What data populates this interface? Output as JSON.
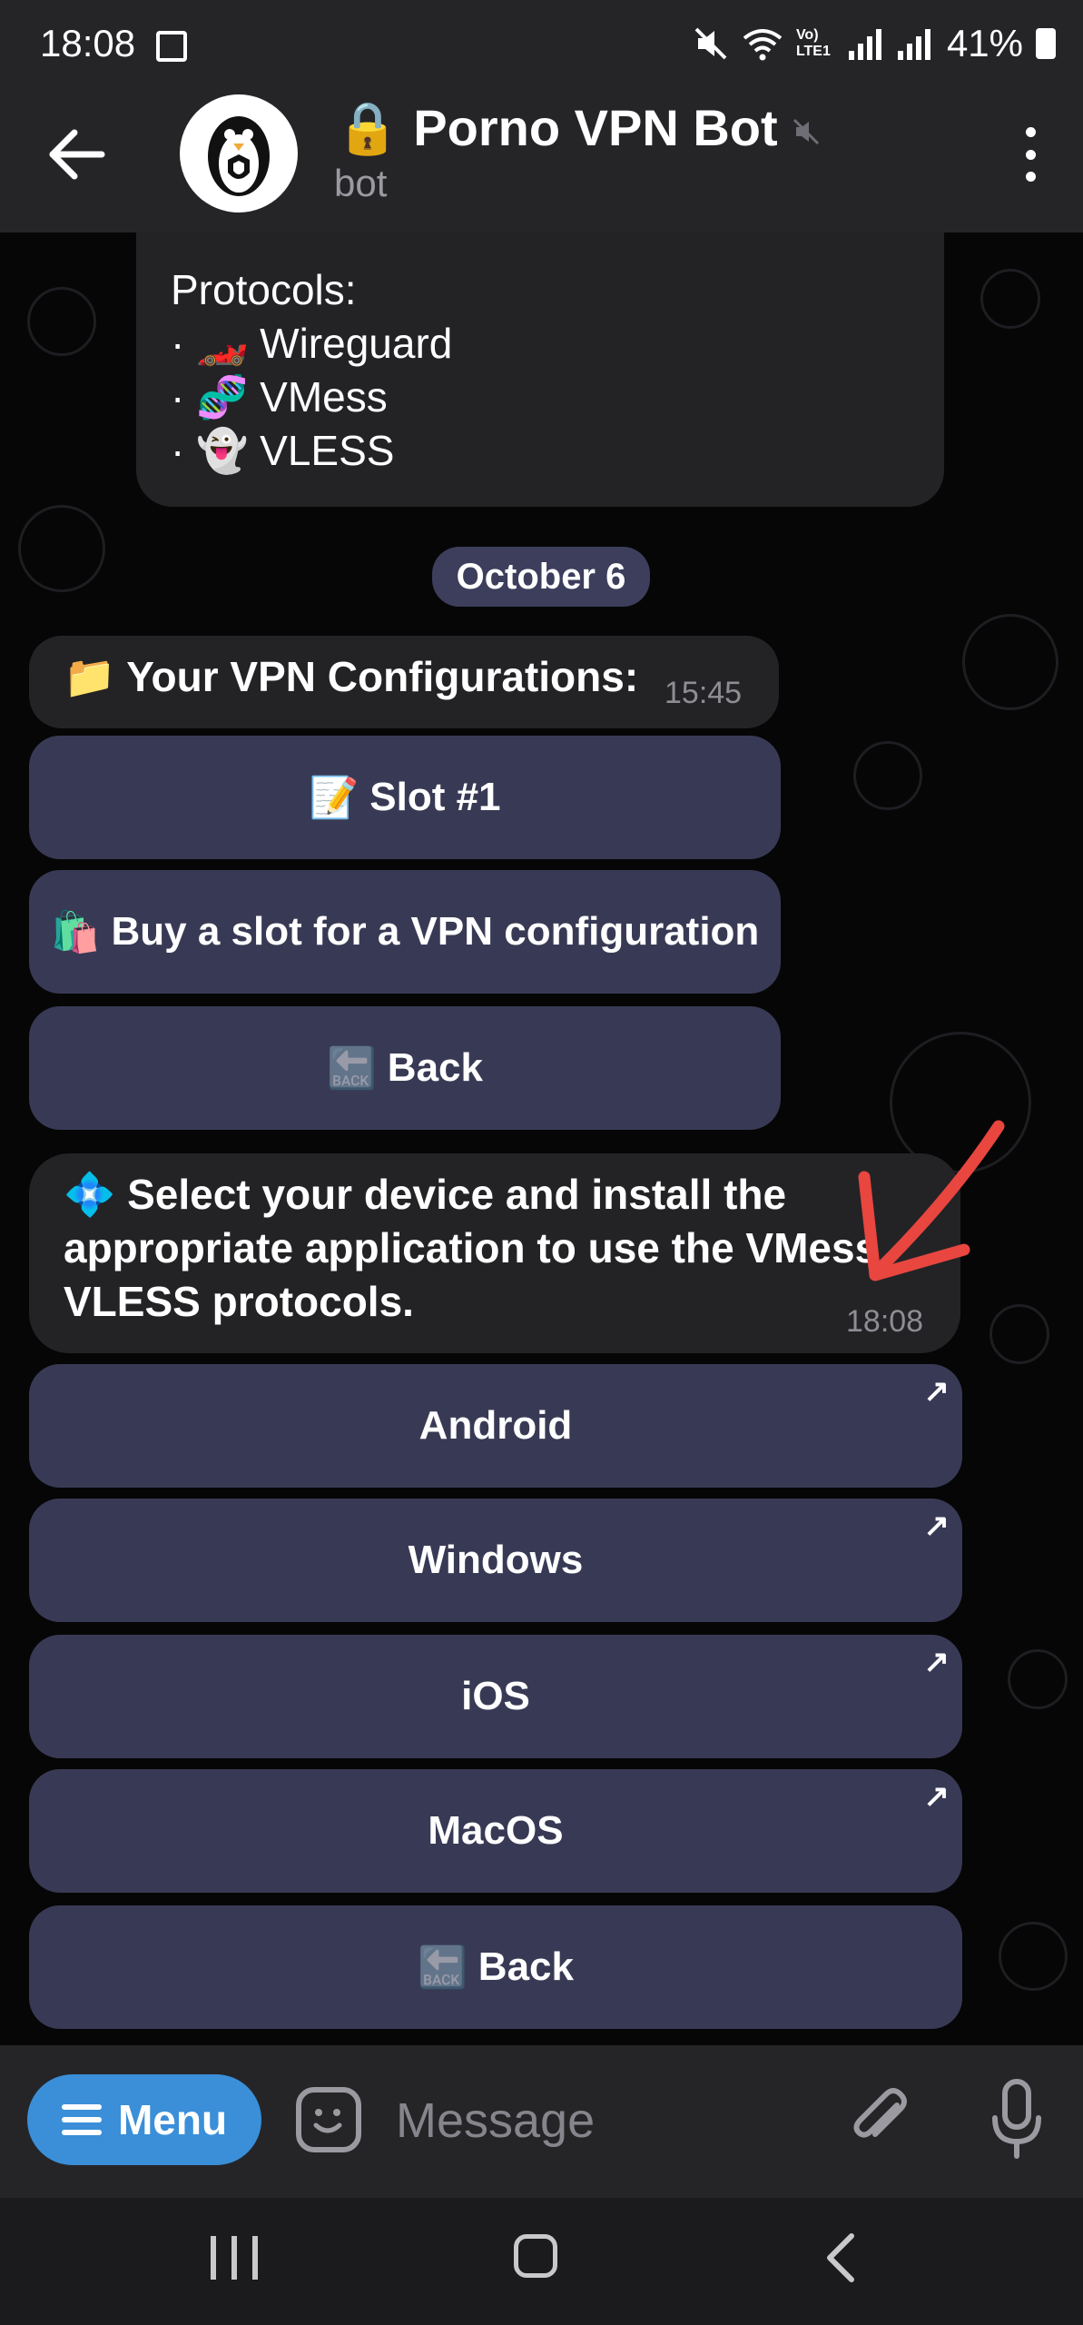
{
  "status_bar": {
    "time": "18:08",
    "network_label": "Vo) LTE1",
    "battery": "41%"
  },
  "header": {
    "title": "Porno VPN Bot",
    "title_prefix_emoji": "🔒",
    "subtitle": "bot"
  },
  "protocols_message": {
    "heading": "Protocols:",
    "items": [
      {
        "bullet": "·",
        "emoji": "🏎️",
        "label": "Wireguard"
      },
      {
        "bullet": "·",
        "emoji": "🧬",
        "label": "VMess"
      },
      {
        "bullet": "·",
        "emoji": "👻",
        "label": "VLESS"
      }
    ]
  },
  "date_separator": "October 6",
  "configs_message": {
    "emoji": "📁",
    "text": "Your VPN Configurations:",
    "time": "15:45"
  },
  "configs_buttons": [
    {
      "emoji": "📝",
      "label": "Slot #1"
    },
    {
      "emoji": "🛍️",
      "label": "Buy a slot for a VPN configuration"
    },
    {
      "emoji": "🔙",
      "label": "Back"
    }
  ],
  "device_message": {
    "emoji": "💠",
    "text": "Select your device and install the appropriate application to use the VMess VLESS protocols.",
    "time": "18:08"
  },
  "device_buttons": [
    {
      "label": "Android",
      "link_icon": "↗"
    },
    {
      "label": "Windows",
      "link_icon": "↗"
    },
    {
      "label": "iOS",
      "link_icon": "↗"
    },
    {
      "label": "MacOS",
      "link_icon": "↗"
    },
    {
      "label": "Back",
      "emoji": "🔙"
    }
  ],
  "composer": {
    "menu_label": "Menu",
    "placeholder": "Message"
  },
  "icons": {
    "header": [
      "back-arrow-icon",
      "bot-avatar-icon",
      "muted-icon",
      "more-options-icon"
    ],
    "composer": [
      "menu-icon",
      "sticker-icon",
      "attach-icon",
      "microphone-icon"
    ],
    "nav": [
      "recent-apps-icon",
      "home-icon",
      "nav-back-icon"
    ]
  },
  "colors": {
    "bar_background": "#252528",
    "chat_background": "#060607",
    "bubble": "#232326",
    "button": "#383a55",
    "menu_button": "#3a8fd8",
    "annotation_arrow": "#e8463f"
  }
}
